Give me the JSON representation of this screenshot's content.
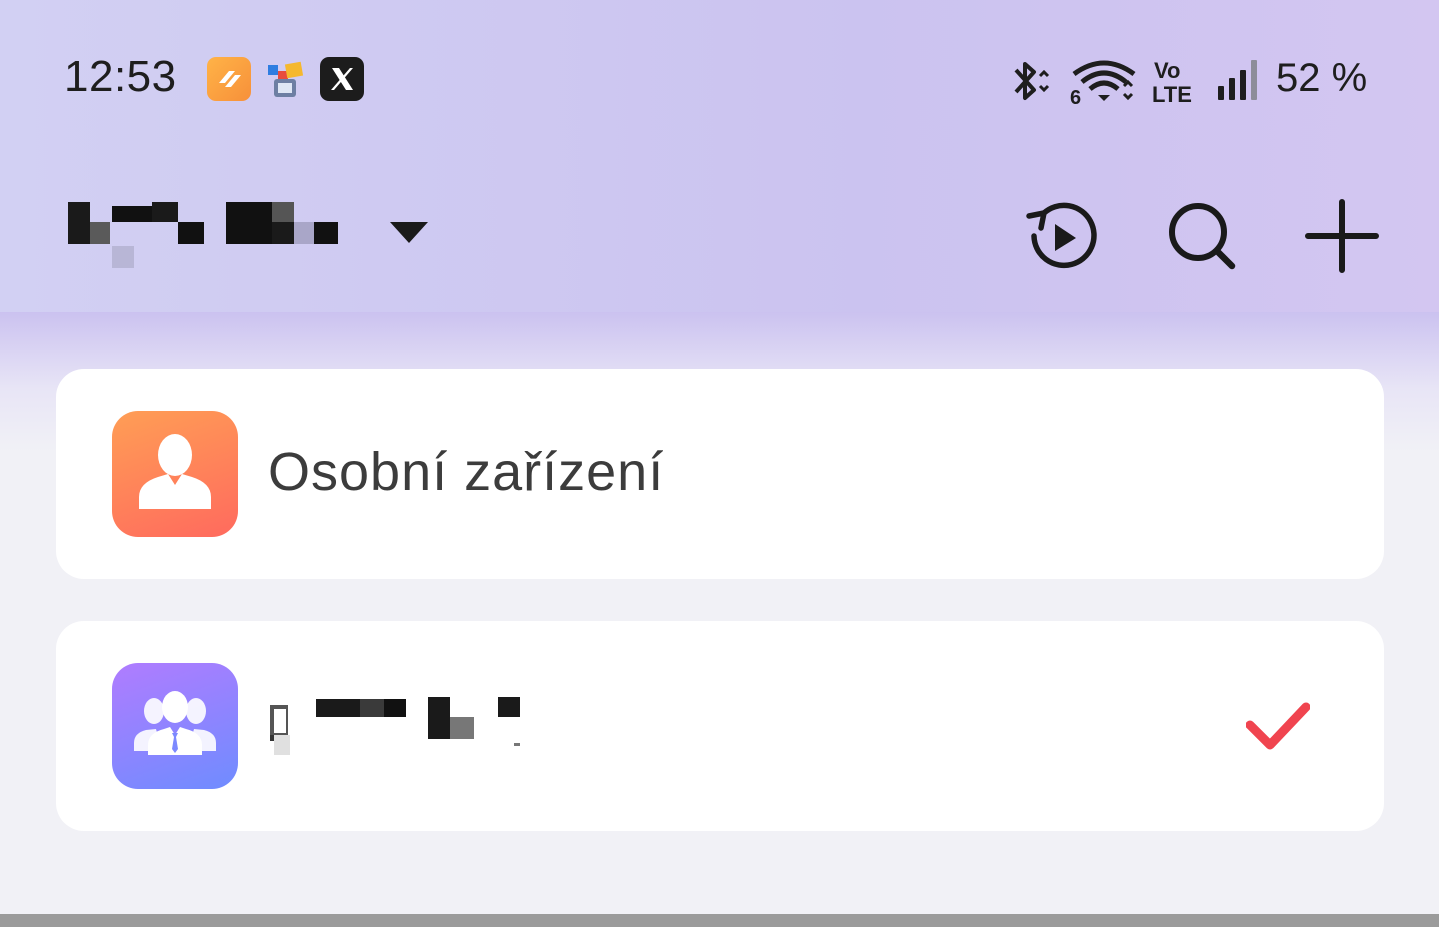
{
  "status_bar": {
    "time": "12:53",
    "notifications": [
      "orange-app-icon",
      "multicolor-app-icon",
      "x-app-icon"
    ],
    "battery": "52 %",
    "icons": [
      "bluetooth-icon",
      "wifi-6-icon",
      "volte-icon",
      "cell-signal-icon"
    ]
  },
  "header": {
    "account_name": "",
    "actions": [
      "history-icon",
      "search-icon",
      "add-icon"
    ]
  },
  "spaces": [
    {
      "label": "Osobní zařízení",
      "icon": "person-icon",
      "selected": false
    },
    {
      "label": "",
      "icon": "team-icon",
      "selected": true
    }
  ],
  "colors": {
    "accent_check": "#f0444f",
    "personal_icon": "#ff7d5a",
    "team_icon": "#8e85ff"
  }
}
